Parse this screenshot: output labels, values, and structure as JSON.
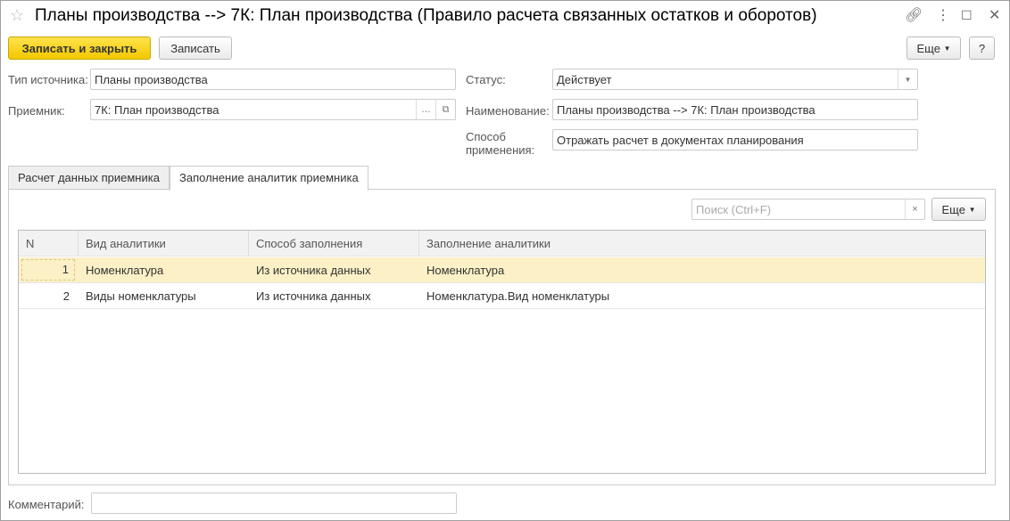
{
  "window": {
    "title": "Планы производства --> 7К: План производства (Правило расчета связанных остатков и оборотов)"
  },
  "toolbar": {
    "save_close": "Записать и закрыть",
    "save": "Записать",
    "more": "Еще",
    "help": "?"
  },
  "form": {
    "source_type_label": "Тип источника:",
    "source_type_value": "Планы производства",
    "receiver_label": "Приемник:",
    "receiver_value": "7К: План производства",
    "status_label": "Статус:",
    "status_value": "Действует",
    "name_label": "Наименование:",
    "name_value": "Планы производства --> 7К: План производства",
    "method_label": "Способ применения:",
    "method_value": "Отражать расчет в документах планирования",
    "comment_label": "Комментарий:",
    "comment_value": ""
  },
  "tabs": [
    {
      "label": "Расчет данных приемника"
    },
    {
      "label": "Заполнение аналитик приемника"
    }
  ],
  "table": {
    "search_placeholder": "Поиск (Ctrl+F)",
    "more": "Еще",
    "columns": [
      "N",
      "Вид аналитики",
      "Способ заполнения",
      "Заполнение аналитики"
    ],
    "rows": [
      {
        "n": "1",
        "kind": "Номенклатура",
        "method": "Из источника данных",
        "fill": "Номенклатура"
      },
      {
        "n": "2",
        "kind": "Виды номенклатуры",
        "method": "Из источника данных",
        "fill": "Номенклатура.Вид номенклатуры"
      }
    ]
  }
}
